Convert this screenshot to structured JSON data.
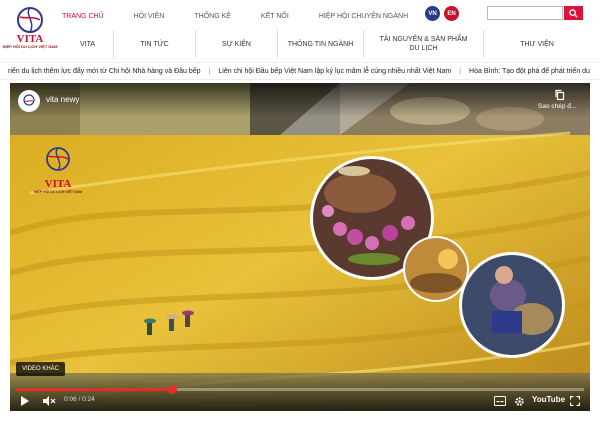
{
  "logo": {
    "text": "VITA",
    "subtitle": "HIỆP HỘI DU LỊCH VIỆT NAM"
  },
  "topnav": [
    "TRANG CHỦ",
    "HỘI VIÊN",
    "THỐNG KÊ",
    "KẾT NỐI",
    "HIỆP HỘI CHUYÊN NGÀNH"
  ],
  "lang": {
    "vn": "VN",
    "en": "EN"
  },
  "search": {
    "value": ""
  },
  "mainnav": [
    "VITA",
    "TIN TỨC",
    "SỰ KIỆN",
    "THÔNG TIN NGÀNH",
    "TÀI NGUYÊN & SẢN PHẨM DU LỊCH",
    "THƯ VIỆN"
  ],
  "ticker": [
    "riển du lịch thêm lực đẩy mới từ Chi hội Nhà hàng và Đầu bếp",
    "Liên chi hội Đầu bếp Việt Nam lập kỷ lục mâm lễ cúng nhiều nhất Việt Nam",
    "Hòa Bình: Tạo đột phá để phát triển du"
  ],
  "video": {
    "channel": "vita newy",
    "copy_label": "Sao chép đ...",
    "brand": "VITA",
    "brand_sub": "HIỆP HỘI DU LỊCH VIỆT NAM",
    "more_label": "VIDEO KHÁC",
    "time": "0:06 / 0:24",
    "progress": 0.275,
    "youtube": "YouTube"
  },
  "colors": {
    "accent": "#c8102e",
    "vn": "#2d3a8c",
    "en": "#c8102e"
  }
}
